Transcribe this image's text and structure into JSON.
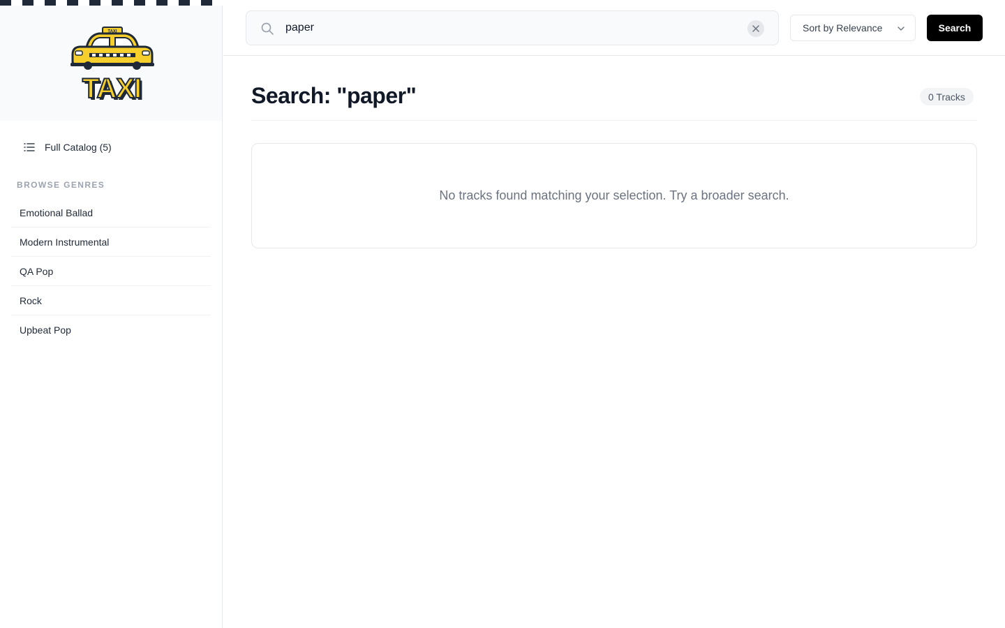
{
  "brand": {
    "logo_text": "TAXI",
    "roof_sign": "TAXI",
    "colors": {
      "yellow": "#f6cf2c",
      "outline": "#1f2937"
    }
  },
  "sidebar": {
    "catalog_label": "Full Catalog (5)",
    "catalog_icon": "list-icon",
    "genres_heading": "BROWSE GENRES",
    "genres": [
      {
        "label": "Emotional Ballad"
      },
      {
        "label": "Modern Instrumental"
      },
      {
        "label": "QA Pop"
      },
      {
        "label": "Rock"
      },
      {
        "label": "Upbeat Pop"
      }
    ]
  },
  "topbar": {
    "search_icon": "search-icon",
    "search_value": "paper",
    "clear_icon": "close-icon",
    "sort_label": "Sort by Relevance",
    "sort_icon": "chevron-down-icon",
    "search_button": "Search"
  },
  "main": {
    "title": "Search: \"paper\"",
    "count_badge": "0 Tracks",
    "empty_message": "No tracks found matching your selection. Try a broader search."
  },
  "colors": {
    "accent": "#000000",
    "sidebar_bg": "#f9fafb",
    "border": "#e5e7eb",
    "muted_text": "#6b7280"
  }
}
